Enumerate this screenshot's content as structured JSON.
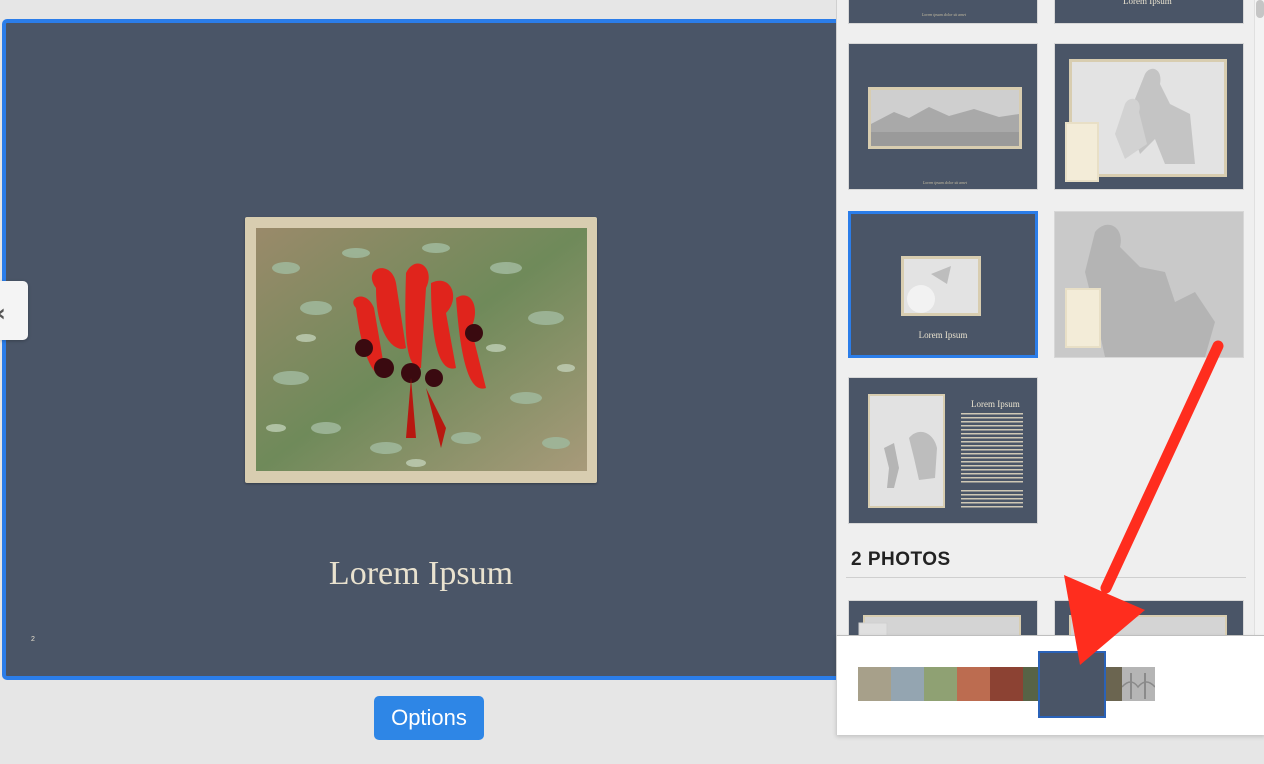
{
  "page": {
    "caption": "Lorem Ipsum",
    "page_number": "2",
    "background": "#4a5567"
  },
  "buttons": {
    "options_label": "Options"
  },
  "panel": {
    "section_2_title": "2 PHOTOS",
    "thumb_caption": "Lorem Ipsum",
    "thumb_heading": "Lorem Ipsum"
  },
  "swatches": [
    {
      "color": "#a7a08a"
    },
    {
      "color": "#94a5b1"
    },
    {
      "color": "#8fa173"
    },
    {
      "color": "#bc6c50"
    },
    {
      "color": "#8c4233"
    },
    {
      "color": "#576346"
    },
    {
      "color": "#4a5567",
      "selected": true
    },
    {
      "color": "#6b6550"
    },
    {
      "color": "#b5b5b5"
    }
  ],
  "accent_color": "#2b7de9",
  "annotation_arrow_color": "#ff2d1e"
}
